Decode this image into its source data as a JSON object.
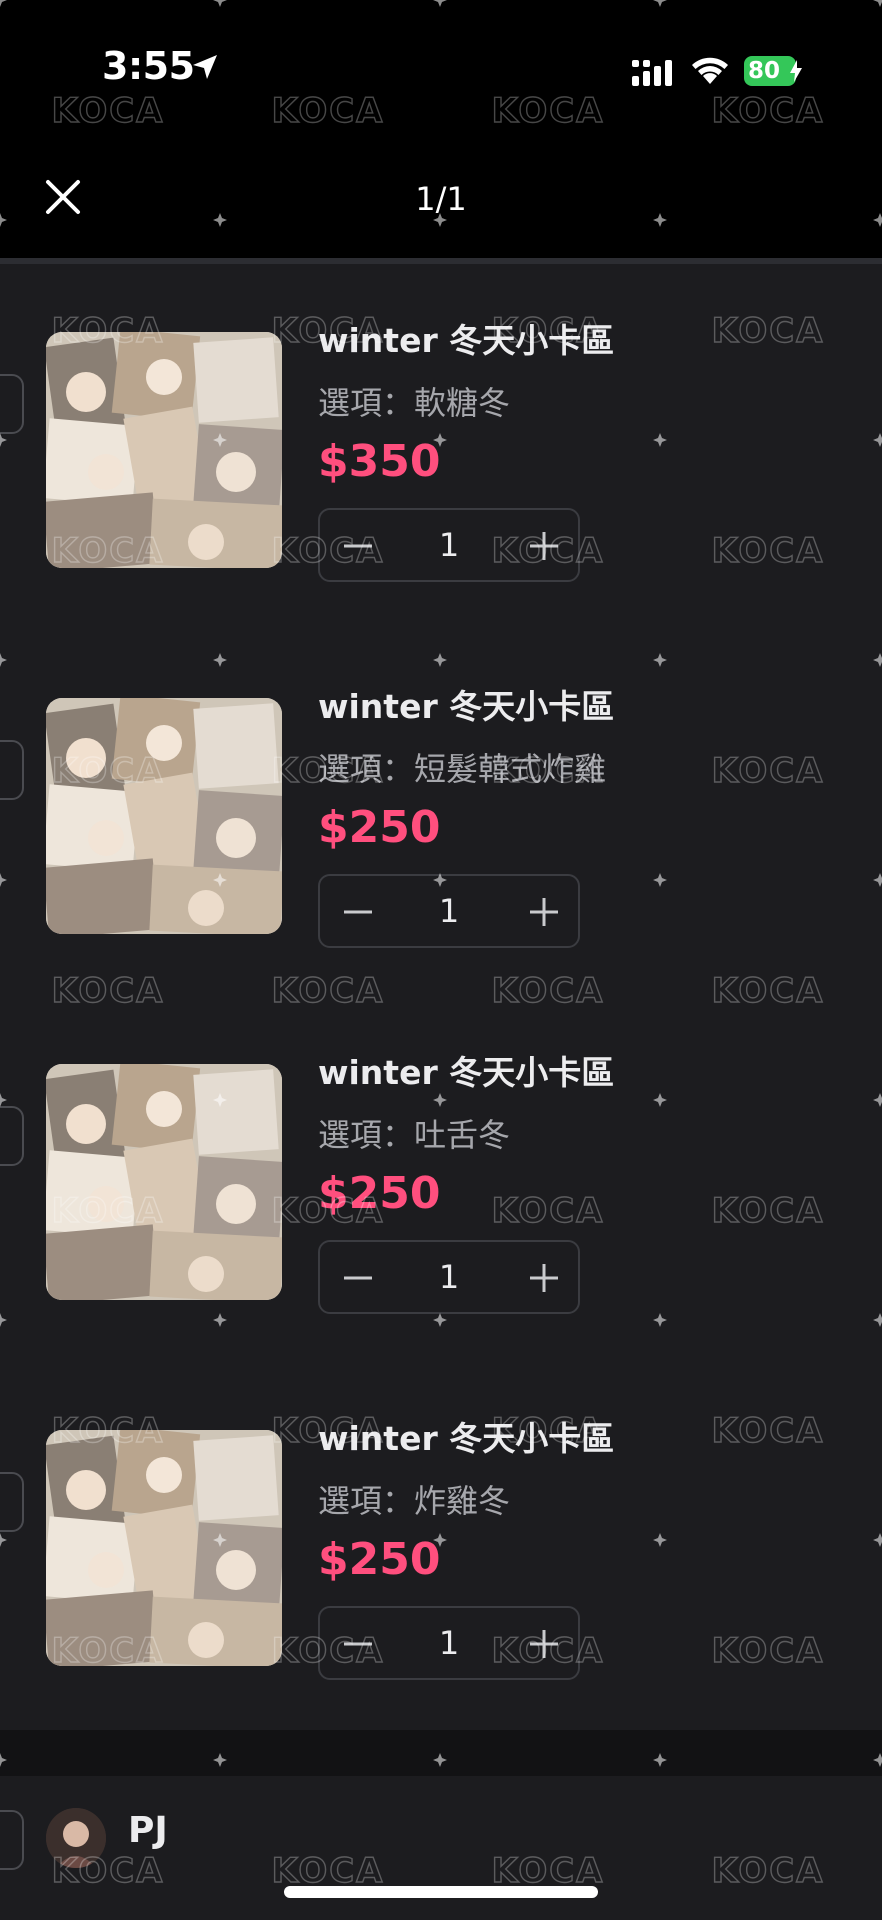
{
  "status_bar": {
    "time": "3:55",
    "battery": "80",
    "icons": [
      "location-arrow-icon",
      "signal-icon",
      "wifi-icon",
      "battery-icon"
    ]
  },
  "header": {
    "page_indicator": "1/1",
    "close_icon": "close-icon"
  },
  "items": [
    {
      "title": "winter 冬天小卡區",
      "option": "選項：軟糖冬",
      "price": "$350",
      "quantity": "1"
    },
    {
      "title": "winter 冬天小卡區",
      "option": "選項：短髮韓式炸雞",
      "price": "$250",
      "quantity": "1"
    },
    {
      "title": "winter 冬天小卡區",
      "option": "選項：吐舌冬",
      "price": "$250",
      "quantity": "1"
    },
    {
      "title": "winter 冬天小卡區",
      "option": "選項：炸雞冬",
      "price": "$250",
      "quantity": "1"
    }
  ],
  "seller": {
    "name": "PJ"
  },
  "watermark": {
    "text": "KOCA"
  },
  "colors": {
    "background": "#1c1c1f",
    "price": "#ff4f7e",
    "battery": "#34c759"
  }
}
